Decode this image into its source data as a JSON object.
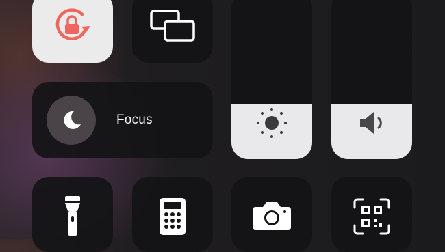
{
  "control_center": {
    "tiles": {
      "rotation_lock": {
        "icon": "rotation-lock-icon",
        "active": true,
        "accent": "#f0665f"
      },
      "screen_mirroring": {
        "icon": "screen-mirroring-icon"
      },
      "focus": {
        "label": "Focus",
        "icon": "moon-icon"
      },
      "brightness": {
        "icon": "sun-icon",
        "level_fraction": 0.33
      },
      "volume": {
        "icon": "speaker-icon",
        "level_fraction": 0.33
      },
      "flashlight": {
        "icon": "flashlight-icon"
      },
      "calculator": {
        "icon": "calculator-icon"
      },
      "camera": {
        "icon": "camera-icon"
      },
      "code_scanner": {
        "icon": "qr-code-icon"
      }
    },
    "colors": {
      "tile_bg": "#141416",
      "active_tile_bg": "#ecebec",
      "slider_fill": "#e9e9eb"
    }
  }
}
